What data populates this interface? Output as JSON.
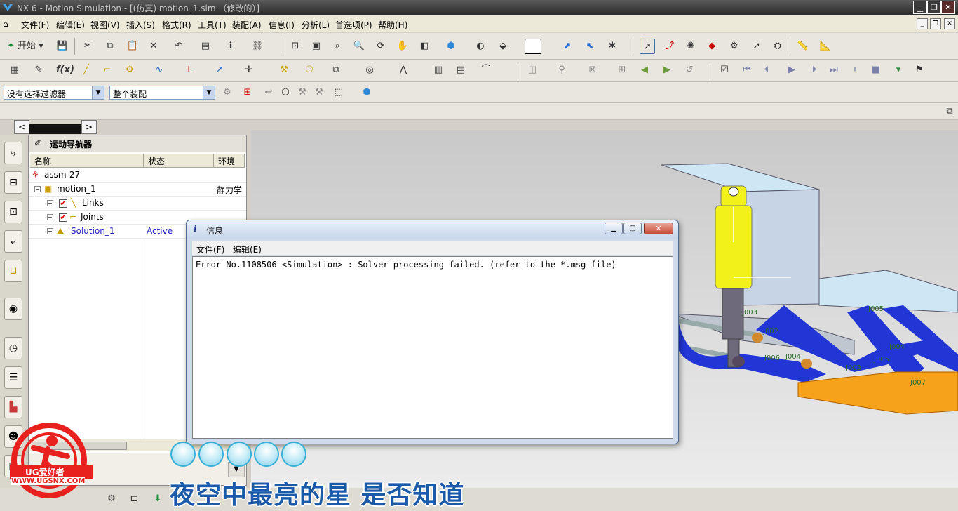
{
  "window": {
    "title": "NX 6 - Motion Simulation - [(仿真) motion_1.sim （修改的）]"
  },
  "menubar": {
    "items": [
      "文件(F)",
      "编辑(E)",
      "视图(V)",
      "插入(S)",
      "格式(R)",
      "工具(T)",
      "装配(A)",
      "信息(I)",
      "分析(L)",
      "首选项(P)",
      "帮助(H)"
    ]
  },
  "toolbar": {
    "start_label": "开始"
  },
  "selection_bar": {
    "filter_value": "没有选择过滤器",
    "scope_value": "整个装配"
  },
  "navigator": {
    "title": "运动导航器",
    "columns": [
      "名称",
      "状态",
      "环境"
    ],
    "rows": [
      {
        "name": "assm-27",
        "status": "",
        "env": ""
      },
      {
        "name": "motion_1",
        "status": "",
        "env": "静力学"
      },
      {
        "name": "Links",
        "status": "",
        "env": ""
      },
      {
        "name": "Joints",
        "status": "",
        "env": ""
      },
      {
        "name": "Solution_1",
        "status": "Active",
        "env": ""
      }
    ]
  },
  "dialog": {
    "title": "信息",
    "menu": [
      "文件(F)",
      "编辑(E)"
    ],
    "message": "Error No.1108506 <Simulation> : Solver processing failed. (refer to the *.msg file)"
  },
  "viewport": {
    "labels": [
      "J002",
      "J003",
      "J004",
      "J005",
      "J006",
      "J007",
      "J005",
      "J004",
      "J003",
      "J008"
    ]
  },
  "overlay": {
    "caption": "夜空中最亮的星 是否知道",
    "watermark_site": "WWW.UGSNX.COM",
    "watermark_brand": "UG爱好者"
  },
  "colors": {
    "viewport_bg": "#d8d8d8",
    "link_blue": "#2236d6",
    "shock_yellow": "#f2f21a",
    "part_orange": "#f6a21a",
    "caption_blue": "#1a5aa8",
    "active_status": "#2020c0"
  }
}
